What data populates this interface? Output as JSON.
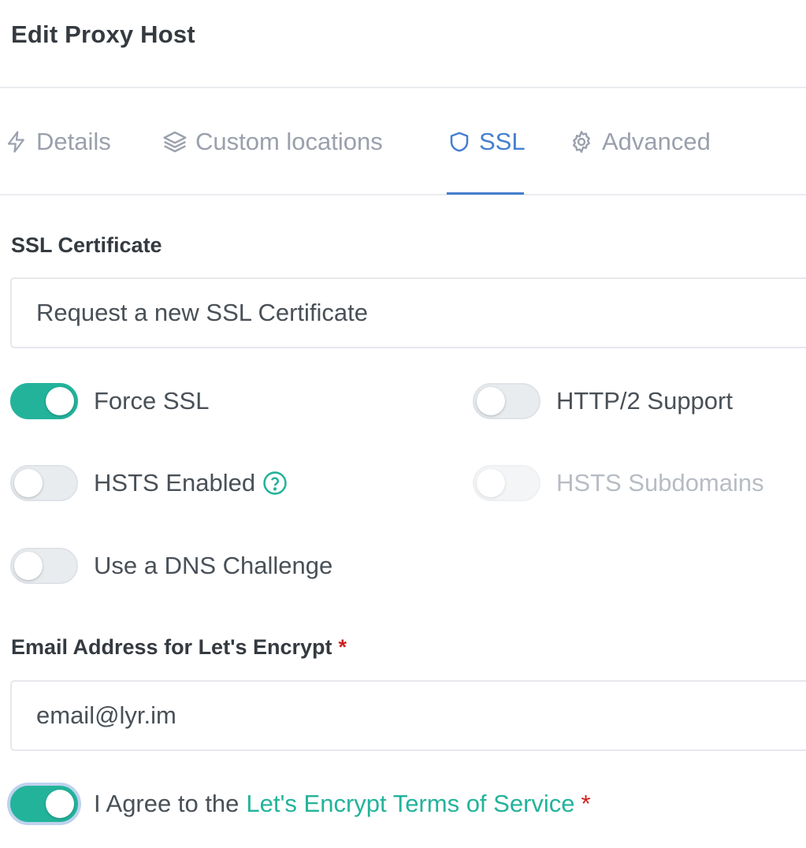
{
  "modal": {
    "title": "Edit Proxy Host"
  },
  "tabs": [
    {
      "label": "Details",
      "icon": "lightning-icon",
      "active": false
    },
    {
      "label": "Custom locations",
      "icon": "layers-icon",
      "active": false
    },
    {
      "label": "SSL",
      "icon": "shield-icon",
      "active": true
    },
    {
      "label": "Advanced",
      "icon": "gear-icon",
      "active": false
    }
  ],
  "ssl": {
    "certificate_label": "SSL Certificate",
    "certificate_value": "Request a new SSL Certificate",
    "toggles": {
      "force_ssl": {
        "label": "Force SSL",
        "on": true
      },
      "http2": {
        "label": "HTTP/2 Support",
        "on": false
      },
      "hsts": {
        "label": "HSTS Enabled",
        "on": false,
        "help_icon": "question-circle-icon"
      },
      "hsts_subdomains": {
        "label": "HSTS Subdomains",
        "on": false,
        "disabled": true
      },
      "dns_challenge": {
        "label": "Use a DNS Challenge",
        "on": false
      }
    },
    "email_label": "Email Address for Let's Encrypt",
    "required_mark": "*",
    "email_value": "email@lyr.im",
    "agree": {
      "prefix": "I Agree to the",
      "link_text": "Let's Encrypt Terms of Service",
      "on": true
    }
  },
  "colors": {
    "accent_blue": "#467fcf",
    "toggle_on": "#23b39b",
    "link": "#23b39b",
    "required": "#cd201f"
  }
}
